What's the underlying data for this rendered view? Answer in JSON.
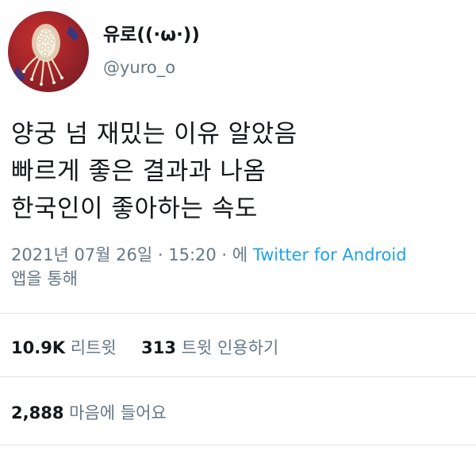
{
  "user": {
    "display_name": "유로((·ω·))",
    "handle": "@yuro_o",
    "avatar_icon": "profile-avatar-image"
  },
  "tweet": {
    "lines": [
      "양궁 넘 재밌는 이유 알았음",
      "빠르게 좋은 결과과 나옴",
      "한국인이 좋아하는 속도"
    ]
  },
  "meta": {
    "timestamp": "2021년 07월 26일 · 15:20 · 에",
    "source": "Twitter for Android",
    "suffix": "앱을 통해"
  },
  "stats": {
    "retweets": {
      "count": "10.9K",
      "label": "리트윗"
    },
    "quotes": {
      "count": "313",
      "label": "트윗 인용하기"
    },
    "likes": {
      "count": "2,888",
      "label": "마음에 들어요"
    }
  },
  "colors": {
    "text": "#14171a",
    "secondary": "#657786",
    "link": "#1da1f2",
    "divider": "#dfe3e6"
  }
}
